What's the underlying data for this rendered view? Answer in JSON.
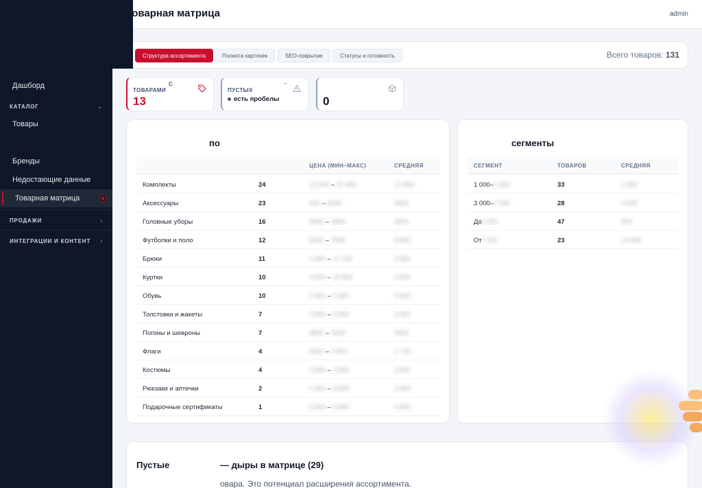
{
  "header": {
    "title": "Товарная матрица",
    "user": "admin"
  },
  "sidebar": {
    "items": [
      {
        "label": "Дашборд"
      },
      {
        "section": "КАТАЛОГ"
      },
      {
        "label": "Товары"
      },
      {
        "label": "Бренды"
      },
      {
        "label": "Недостающие данные"
      },
      {
        "label": "Товарная матрица"
      },
      {
        "section": "ПРОДАЖИ"
      },
      {
        "section": "ИНТЕГРАЦИИ И КОНТЕНТ"
      }
    ]
  },
  "tabs": [
    {
      "label": "Структура ассортимента"
    },
    {
      "label": "Полнота карточек"
    },
    {
      "label": "SEO-покрытие"
    },
    {
      "label": "Статусы и готовность"
    }
  ],
  "total": {
    "label": "Всего товаров:",
    "value": "131"
  },
  "stats": [
    {
      "label": "ТОВАРАМИ",
      "value": "13",
      "corner": "С"
    },
    {
      "label": "ПУСТЫХ",
      "value": "есть пробелы",
      "corner": "–"
    },
    {
      "label": "",
      "value": "0"
    }
  ],
  "categories": {
    "title": "по",
    "columns": [
      "",
      "",
      "ЦЕНА (МИН–МАКС)",
      "СРЕДНЯЯ"
    ],
    "rows": [
      {
        "name": "Комплекты",
        "count": "24",
        "min": "12 000",
        "max": "37 800",
        "avg": "17 800"
      },
      {
        "name": "Аксессуары",
        "count": "23",
        "min": "600",
        "max": "8000",
        "avg": "3600"
      },
      {
        "name": "Головные уборы",
        "count": "16",
        "min": "3800",
        "max": "5800",
        "avg": "3500"
      },
      {
        "name": "Футболки и поло",
        "count": "12",
        "min": "4000",
        "max": "7800",
        "avg": "5 800"
      },
      {
        "name": "Брюки",
        "count": "11",
        "min": "1 800",
        "max": "17 000",
        "avg": "3 800"
      },
      {
        "name": "Куртки",
        "count": "10",
        "min": "4 800",
        "max": "10 800",
        "avg": "9 500"
      },
      {
        "name": "Обувь",
        "count": "10",
        "min": "4 800",
        "max": "5 800",
        "avg": "5 500"
      },
      {
        "name": "Толстовки и жакеты",
        "count": "7",
        "min": "3 800",
        "max": "5 800",
        "avg": "4 800"
      },
      {
        "name": "Погоны и шевроны",
        "count": "7",
        "min": "3800",
        "max": "3000",
        "avg": "3600"
      },
      {
        "name": "Флаги",
        "count": "4",
        "min": "3500",
        "max": "3 800",
        "avg": "1 700"
      },
      {
        "name": "Костюмы",
        "count": "4",
        "min": "3 800",
        "max": "3 800",
        "avg": "3 800"
      },
      {
        "name": "Рюкзаки и аптечки",
        "count": "2",
        "min": "1 800",
        "max": "3 800",
        "avg": "3 800"
      },
      {
        "name": "Подарочные сертификаты",
        "count": "1",
        "min": "5 800",
        "max": "5 800",
        "avg": "5 800"
      }
    ]
  },
  "segments": {
    "title": "сегменты",
    "columns": [
      "СЕГМЕНТ",
      "ТОВАРОВ",
      "СРЕДНЯЯ"
    ],
    "rows": [
      {
        "prefix": "1 000–",
        "range": "3 000",
        "count": "33",
        "avg": "2 500"
      },
      {
        "prefix": "3 000–",
        "range": "7 000",
        "count": "28",
        "avg": "4 500"
      },
      {
        "prefix": "До",
        "range": "1 000",
        "count": "47",
        "avg": "800"
      },
      {
        "prefix": "От",
        "range": "7 000",
        "count": "23",
        "avg": "10 800"
      }
    ]
  },
  "gaps": {
    "title_left": "Пустые",
    "title_right": "— дыры в матрице (29)",
    "description": "овара. Это потенциал расширения ассортимента."
  },
  "colors": {
    "accent": "#c8102e",
    "sidebar": "#0f172a"
  }
}
